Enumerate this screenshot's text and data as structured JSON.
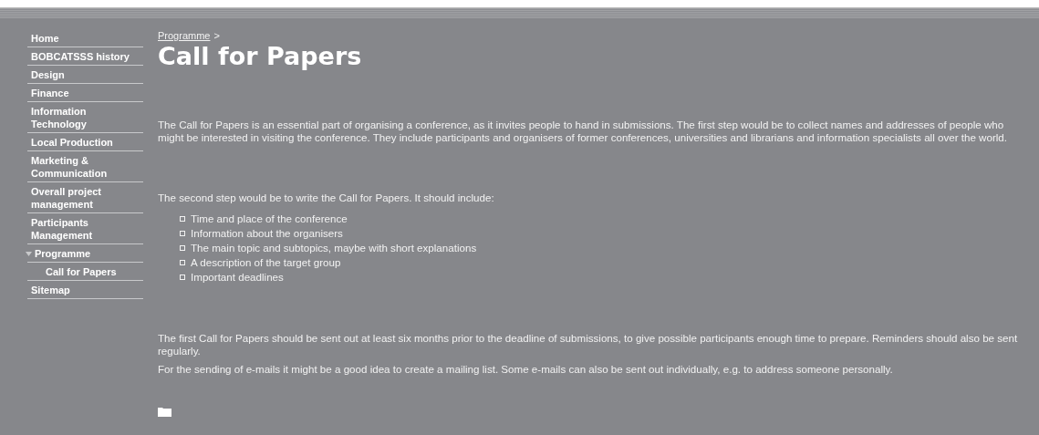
{
  "sidebar": {
    "items": [
      {
        "label": "Home",
        "expanded": false
      },
      {
        "label": "BOBCATSSS history",
        "expanded": false
      },
      {
        "label": "Design",
        "expanded": false
      },
      {
        "label": "Finance",
        "expanded": false
      },
      {
        "label": "Information Technology",
        "expanded": false
      },
      {
        "label": "Local Production",
        "expanded": false
      },
      {
        "label": "Marketing & Communication",
        "expanded": false
      },
      {
        "label": "Overall project management",
        "expanded": false
      },
      {
        "label": "Participants Management",
        "expanded": false
      },
      {
        "label": "Programme",
        "expanded": true,
        "children": [
          {
            "label": "Call for Papers",
            "expanded": false
          }
        ]
      },
      {
        "label": "Sitemap",
        "expanded": false
      }
    ]
  },
  "breadcrumb": {
    "link": "Programme",
    "separator": ">"
  },
  "title": "Call for Papers",
  "content": [
    {
      "kind": "paragraph",
      "text": "The Call for Papers is an essential part of organising a conference, as it invites people to hand in submissions. The first step would be to collect names and addresses of people who might be interested in visiting the conference. They include participants and organisers of former conferences, universities and librarians and information specialists all over the world."
    },
    {
      "kind": "paragraph",
      "text": "The second step would be to write the Call for Papers. It should include:"
    },
    {
      "kind": "list",
      "items": [
        "Time and place of the conference",
        "Information about the organisers",
        "The main topic and subtopics, maybe with short explanations",
        "A description of the target group",
        "Important deadlines"
      ]
    },
    {
      "kind": "paragraph",
      "text": "The first Call for Papers should be sent out at least six months prior to the deadline of submissions, to give possible participants enough time to prepare. Reminders should also be sent regularly."
    },
    {
      "kind": "tight",
      "text": "For the sending of e-mails it might be a good idea to create a mailing list. Some e-mails can also be sent out individually, e.g. to address someone personally."
    }
  ]
}
